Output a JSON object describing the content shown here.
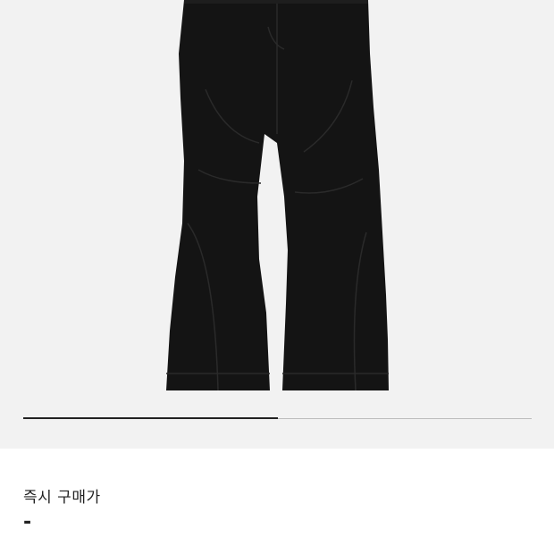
{
  "product": {
    "image_icon": "black-flared-denim-pants-image",
    "colors": {
      "gallery_background": "#f2f2f2",
      "pants": "#141414",
      "progress_fill": "#222222",
      "progress_track": "#bdbdbd"
    }
  },
  "carousel": {
    "progress": 0.5
  },
  "price": {
    "label": "즉시 구매가",
    "value": "-"
  }
}
